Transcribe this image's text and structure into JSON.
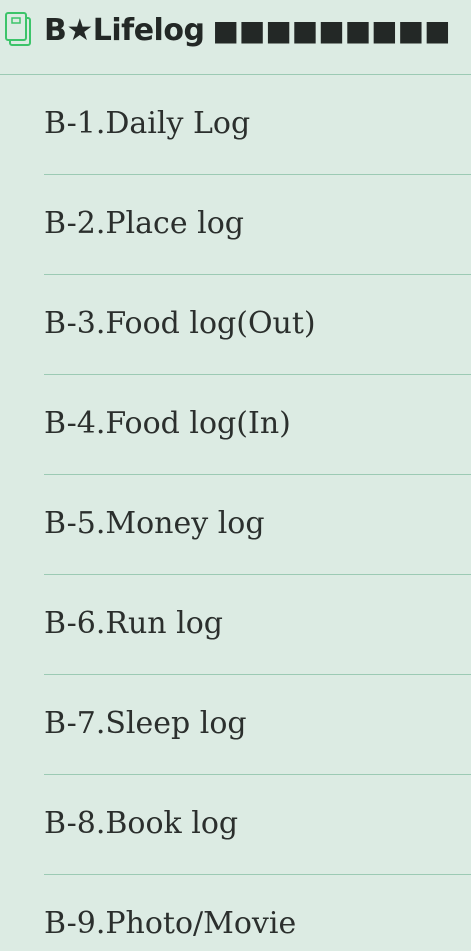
{
  "header": {
    "icon": "notebook-icon",
    "title": "B★Lifelog",
    "extra": "■■■■■■■■■"
  },
  "items": [
    {
      "label": "B-1.Daily Log"
    },
    {
      "label": "B-2.Place log"
    },
    {
      "label": "B-3.Food log(Out)"
    },
    {
      "label": "B-4.Food log(In)"
    },
    {
      "label": "B-5.Money log"
    },
    {
      "label": "B-6.Run log"
    },
    {
      "label": "B-7.Sleep log"
    },
    {
      "label": "B-8.Book log"
    },
    {
      "label": "B-9.Photo/Movie"
    }
  ],
  "colors": {
    "background": "#dcebe3",
    "divider": "#9ccab4",
    "icon": "#3cc46a",
    "text": "#2b2f2d"
  }
}
